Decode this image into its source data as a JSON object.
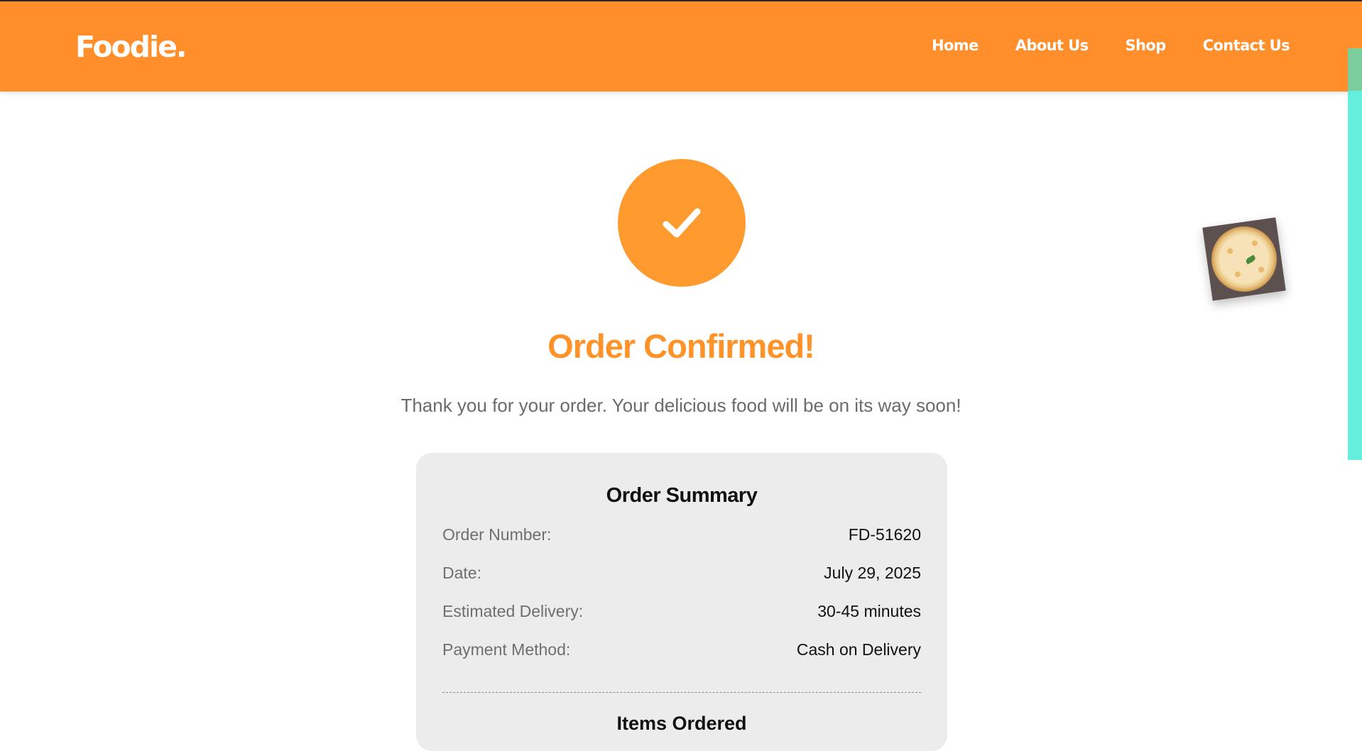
{
  "nav": {
    "logo": "Foodie.",
    "links": [
      "Home",
      "About Us",
      "Shop",
      "Contact Us"
    ]
  },
  "confirmation": {
    "icon": "check-icon",
    "title": "Order Confirmed!",
    "message": "Thank you for your order. Your delicious food will be on its way soon!"
  },
  "summary": {
    "title": "Order Summary",
    "rows": [
      {
        "label": "Order Number:",
        "value": "FD-51620"
      },
      {
        "label": "Date:",
        "value": "July 29, 2025"
      },
      {
        "label": "Estimated Delivery:",
        "value": "30-45 minutes"
      },
      {
        "label": "Payment Method:",
        "value": "Cash on Delivery"
      }
    ],
    "items_title": "Items Ordered"
  },
  "colors": {
    "primary": "#ff8e2b",
    "accent_title": "#ff932a",
    "card_bg": "#ececec",
    "side_strip": "#63efdc"
  },
  "decor": {
    "floating_image": "pizza-image"
  }
}
